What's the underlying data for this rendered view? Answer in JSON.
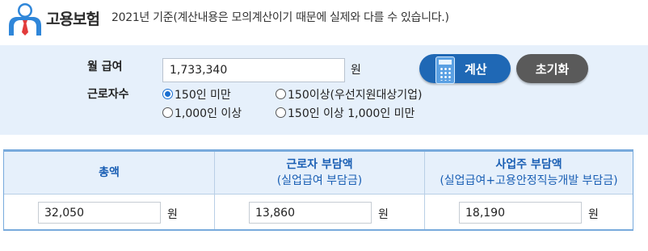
{
  "header": {
    "logo_text": "고용보험",
    "subtitle": "2021년 기준(계산내용은 모의계산이기 때문에 실제와 다를 수 있습니다.)"
  },
  "form": {
    "wage_label": "월 급여",
    "wage_value": "1,733,340",
    "wage_unit": "원",
    "workers_label": "근로자수",
    "options": [
      {
        "label": "150인 미만",
        "selected": true
      },
      {
        "label": "150이상(우선지원대상기업)",
        "selected": false
      },
      {
        "label": "1,000인 이상",
        "selected": false
      },
      {
        "label": "150인 이상 1,000인 미만",
        "selected": false
      }
    ],
    "calc_button": "계산",
    "reset_button": "초기화"
  },
  "results": {
    "columns": [
      {
        "title": "총액",
        "subtitle": ""
      },
      {
        "title": "근로자 부담액",
        "subtitle": "(실업급여 부담금)"
      },
      {
        "title": "사업주 부담액",
        "subtitle": "(실업급여+고용안정직능개발 부담금)"
      }
    ],
    "values": [
      "32,050",
      "13,860",
      "18,190"
    ],
    "unit": "원"
  },
  "colors": {
    "accent": "#1f68b5",
    "panel_bg": "#e6f0fb",
    "header_text": "#1a5fb4",
    "reset_button": "#5a5a5a"
  }
}
